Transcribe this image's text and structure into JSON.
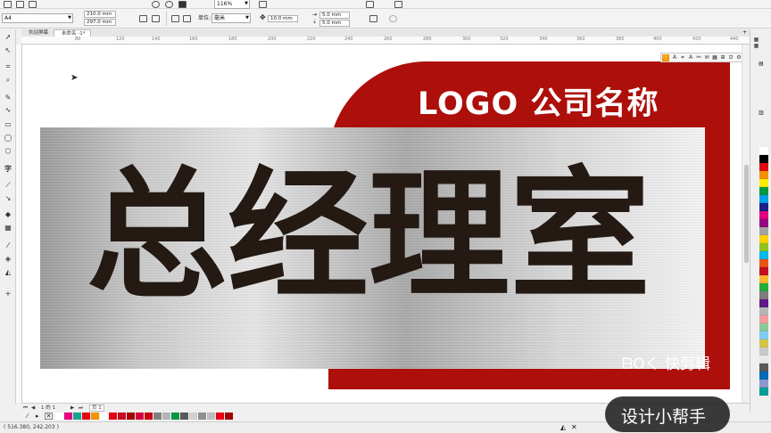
{
  "toolbar": {
    "page_size": "A4",
    "width": "210.0 mm",
    "height": "297.0 mm",
    "zoom": "116%",
    "units_label": "单位:",
    "units_value": "毫米",
    "nudge": "10.0 mm",
    "dup_x": "5.0 mm",
    "dup_y": "5.0 mm"
  },
  "tabs": [
    {
      "label": "欢迎屏幕"
    },
    {
      "label": "未命名 -1*"
    }
  ],
  "ruler": {
    "ticks": [
      "80",
      "120",
      "140",
      "160",
      "180",
      "200",
      "220",
      "240",
      "260",
      "280",
      "300",
      "320",
      "340",
      "360",
      "380",
      "400",
      "420",
      "440"
    ]
  },
  "design": {
    "logo_text": "LOGO  公司名称",
    "title_text": "总经理室",
    "canvas_watermark": "ᗷOく 快剪辑"
  },
  "page_nav": {
    "current": "1 的 1",
    "page_tab": "页 1"
  },
  "status": {
    "coordinates": "( 516.380, 242.203 )"
  },
  "watermark": {
    "text": "设计小帮手"
  },
  "colors": {
    "red_plate": "#ad0f0b",
    "title_text": "#241913",
    "logo_text": "#ffffff"
  },
  "palette_right": [
    "#ffffff",
    "#000000",
    "#e30613",
    "#f39200",
    "#ffed00",
    "#009640",
    "#00a0e9",
    "#1d2088",
    "#e4007f",
    "#920783",
    "#a3a3a3",
    "#fdd000",
    "#8fc31f",
    "#00b7ee",
    "#ea5514",
    "#c30d23",
    "#f8b62d",
    "#22ac38",
    "#7d7d7d",
    "#601986",
    "#b5b5b6",
    "#f29c9f",
    "#89c997",
    "#7ecef4",
    "#d7c447",
    "#c9caca",
    "#e8e8e8",
    "#595757",
    "#0068b7",
    "#8c97cb",
    "#009e96"
  ],
  "palette_bottom": [
    "#ffffff",
    "#e4007f",
    "#1aa38b",
    "#e30613",
    "#f39200",
    "#ffffff",
    "#e60012",
    "#c30d23",
    "#a40000",
    "#d4003b",
    "#c9000b",
    "#808080",
    "#b5b5b6",
    "#009944",
    "#595757",
    "#d0d0d0",
    "#8f8f8f",
    "#bebebe",
    "#e60012",
    "#a00000"
  ]
}
